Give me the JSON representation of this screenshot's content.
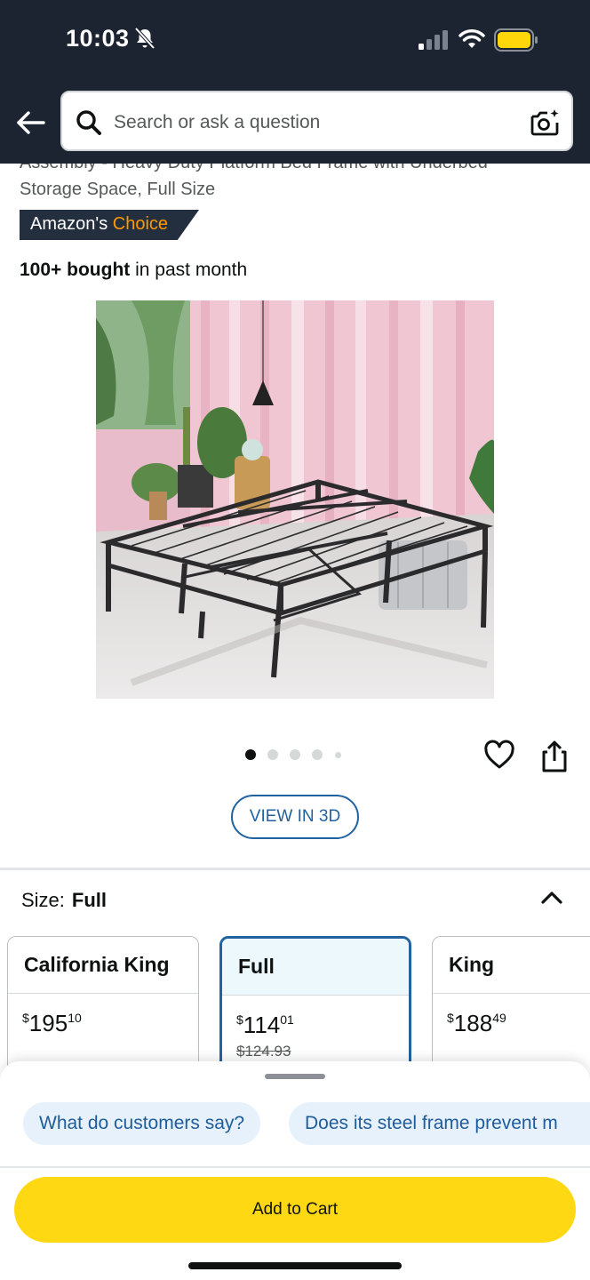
{
  "status_bar": {
    "time": "10:03"
  },
  "header": {
    "search_placeholder": "Search or ask a question"
  },
  "product": {
    "title_cut": "Assembly - Heavy Duty Platform Bed Frame with Underbed",
    "title_line2": "Storage Space, Full Size",
    "badge_prefix": "Amazon's",
    "badge_choice": "Choice",
    "bought_bold": "100+ bought",
    "bought_rest": " in past month",
    "image_count": 5,
    "active_image": 1
  },
  "view3d_label": "VIEW IN 3D",
  "size_selector": {
    "label": "Size:",
    "selected": "Full",
    "options": [
      {
        "name": "California King",
        "currency": "$",
        "whole": "195",
        "cents": "10",
        "was": ""
      },
      {
        "name": "Full",
        "currency": "$",
        "whole": "114",
        "cents": "01",
        "was": "$124.93"
      },
      {
        "name": "King",
        "currency": "$",
        "whole": "188",
        "cents": "49",
        "was": ""
      }
    ]
  },
  "ask_chips": [
    "What do customers say?",
    "Does its steel frame prevent m"
  ],
  "add_to_cart_label": "Add to Cart",
  "colors": {
    "header_bg": "#1b2430",
    "cart_yellow": "#ffd814",
    "link_blue": "#2162a1",
    "badge_orange": "#ff9900"
  }
}
